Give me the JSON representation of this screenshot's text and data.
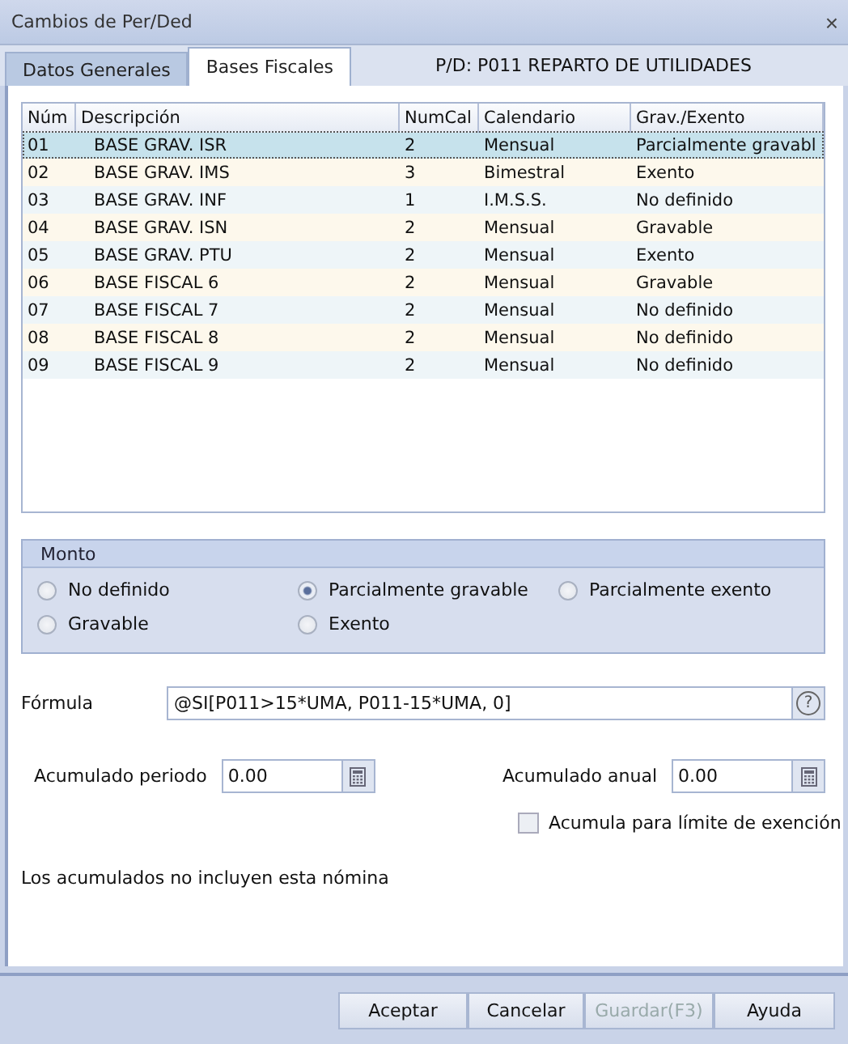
{
  "window": {
    "title": "Cambios de Per/Ded",
    "close": "×"
  },
  "tabs": [
    {
      "label": "Datos Generales",
      "selected": false
    },
    {
      "label": "Bases Fiscales",
      "selected": true
    }
  ],
  "header": "P/D: P011  REPARTO DE UTILIDADES",
  "table": {
    "columns": [
      "Núm",
      "Descripción",
      "NumCal",
      "Calendario",
      "Grav./Exento"
    ],
    "rows": [
      {
        "cells": [
          "01",
          "BASE GRAV. ISR",
          "2",
          "Mensual",
          "Parcialmente gravabl"
        ],
        "selected": true
      },
      {
        "cells": [
          "02",
          "BASE GRAV. IMS",
          "3",
          "Bimestral",
          "Exento"
        ],
        "selected": false
      },
      {
        "cells": [
          "03",
          "BASE GRAV. INF",
          "1",
          "I.M.S.S.",
          "No definido"
        ],
        "selected": false
      },
      {
        "cells": [
          "04",
          "BASE GRAV. ISN",
          "2",
          "Mensual",
          "Gravable"
        ],
        "selected": false
      },
      {
        "cells": [
          "05",
          "BASE GRAV. PTU",
          "2",
          "Mensual",
          "Exento"
        ],
        "selected": false
      },
      {
        "cells": [
          "06",
          "BASE FISCAL 6",
          "2",
          "Mensual",
          "Gravable"
        ],
        "selected": false
      },
      {
        "cells": [
          "07",
          "BASE FISCAL 7",
          "2",
          "Mensual",
          "No definido"
        ],
        "selected": false
      },
      {
        "cells": [
          "08",
          "BASE FISCAL 8",
          "2",
          "Mensual",
          "No definido"
        ],
        "selected": false
      },
      {
        "cells": [
          "09",
          "BASE FISCAL 9",
          "2",
          "Mensual",
          "No definido"
        ],
        "selected": false
      }
    ]
  },
  "monto": {
    "title": "Monto",
    "options": [
      {
        "label": "No definido",
        "selected": false
      },
      {
        "label": "Parcialmente gravable",
        "selected": true
      },
      {
        "label": "Parcialmente exento",
        "selected": false
      },
      {
        "label": "Gravable",
        "selected": false
      },
      {
        "label": "Exento",
        "selected": false
      }
    ]
  },
  "formula": {
    "label": "Fórmula",
    "value": "@SI[P011>15*UMA, P011-15*UMA, 0]",
    "help": "?"
  },
  "acumulado_periodo": {
    "label": "Acumulado periodo",
    "value": "0.00"
  },
  "acumulado_anual": {
    "label": "Acumulado anual",
    "value": "0.00"
  },
  "acumula_limite": {
    "label": "Acumula para límite de exención",
    "checked": false
  },
  "note": "Los acumulados no incluyen esta nómina",
  "buttons": [
    {
      "label": "Aceptar",
      "disabled": false
    },
    {
      "label": "Cancelar",
      "disabled": false
    },
    {
      "label": "Guardar(F3)",
      "disabled": true
    },
    {
      "label": "Ayuda",
      "disabled": false
    }
  ]
}
